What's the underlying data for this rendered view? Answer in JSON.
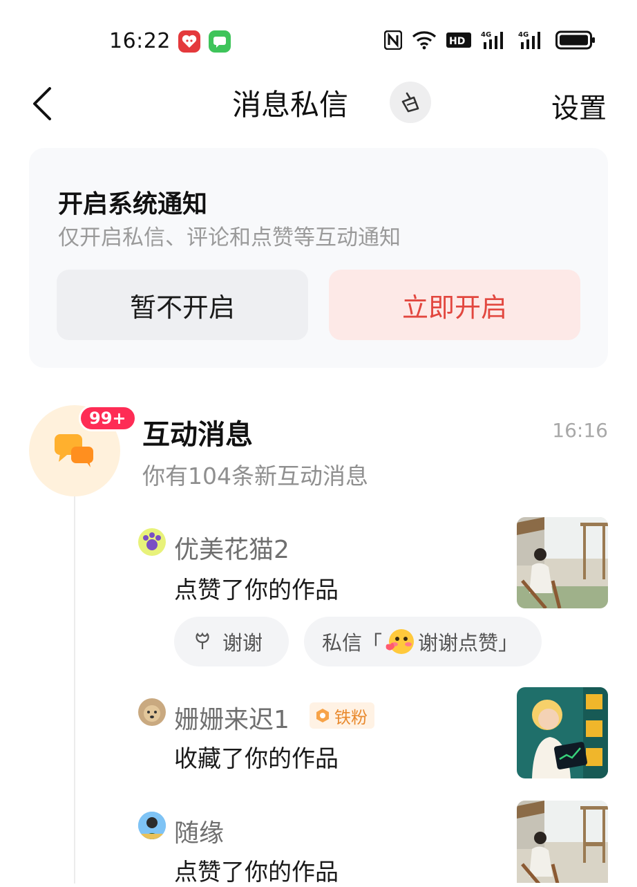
{
  "status_bar": {
    "time": "16:22",
    "app_icons": [
      "pinduoduo-icon",
      "messages-icon"
    ],
    "icons": [
      "nfc-icon",
      "wifi-icon",
      "hd-icon",
      "signal-4g-icon",
      "signal-4g-icon",
      "battery-icon"
    ],
    "hd_label": "HD",
    "net_label": "4G"
  },
  "header": {
    "title": "消息私信",
    "settings_label": "设置"
  },
  "notification_card": {
    "title": "开启系统通知",
    "subtitle": "仅开启私信、评论和点赞等互动通知",
    "later_label": "暂不开启",
    "enable_label": "立即开启"
  },
  "interaction": {
    "title": "互动消息",
    "time": "16:16",
    "badge": "99+",
    "subtitle": "你有104条新互动消息"
  },
  "items": [
    {
      "name": "优美花猫2",
      "action": "点赞了你的作品",
      "quick_replies": {
        "thanks": "谢谢",
        "dm_prefix": "私信「",
        "dm_text": "谢谢点赞」"
      }
    },
    {
      "name": "姗姗来迟1",
      "fan_badge": "铁粉",
      "action": "收藏了你的作品"
    },
    {
      "name": "随缘",
      "action": "点赞了你的作品"
    }
  ],
  "colors": {
    "accent_red": "#e2473f",
    "badge_red": "#fe2c55",
    "orange": "#ffb02e"
  }
}
